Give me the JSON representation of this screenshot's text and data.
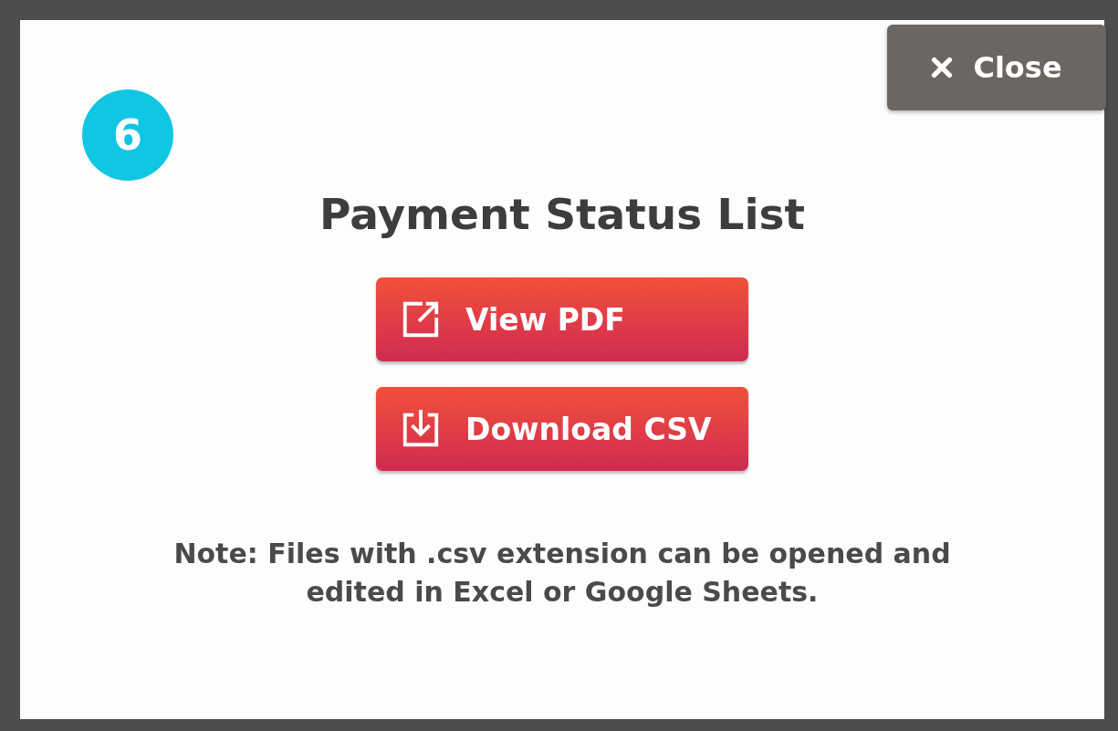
{
  "dialog": {
    "close_button": {
      "label": "Close"
    },
    "step_badge": "6",
    "title": "Payment Status List",
    "actions": [
      {
        "kind": "external",
        "label": "View PDF"
      },
      {
        "kind": "download",
        "label": "Download CSV"
      }
    ],
    "note": "Note: Files with .csv extension can be opened and edited in Excel or Google Sheets."
  }
}
